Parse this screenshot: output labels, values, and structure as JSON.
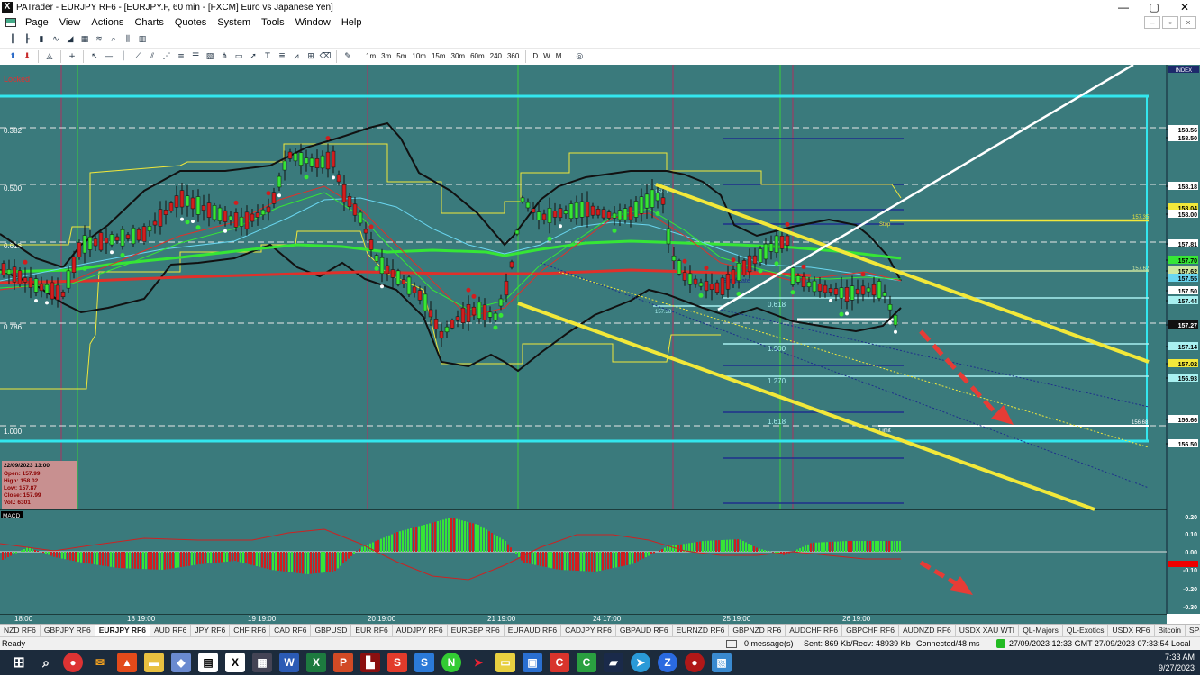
{
  "window": {
    "title": "PATrader - EURJPY RF6 - [EURJPY.F, 60 min - [FXCM] Euro vs Japanese Yen]",
    "controls": [
      "—",
      "▢",
      "✕"
    ]
  },
  "menu": [
    "Page",
    "View",
    "Actions",
    "Charts",
    "Quotes",
    "System",
    "Tools",
    "Window",
    "Help"
  ],
  "timeframes": [
    "1m",
    "3m",
    "5m",
    "10m",
    "15m",
    "30m",
    "60m",
    "240",
    "360",
    "D",
    "W",
    "M"
  ],
  "chart": {
    "locked": "Locked",
    "fib_left": [
      "0.382",
      "0.500",
      "0.618",
      "0.786",
      "1.000"
    ],
    "price_axis": [
      "158.56",
      "158.50",
      "158.18",
      "158.04",
      "158.00",
      "157.81",
      "157.70",
      "157.62",
      "157.55",
      "157.50",
      "157.44",
      "157.27",
      "157.14",
      "157.02",
      "156.93",
      "156.66",
      "156.50"
    ],
    "index_label": "INDEX",
    "macd_label": "MACD",
    "macd_axis": [
      "0.20",
      "0.10",
      "0.00",
      "-0.08",
      "-0.10",
      "-0.20",
      "-0.30"
    ],
    "time_axis": [
      "18:00",
      "18 19:00",
      "19 19:00",
      "20 19:00",
      "21 19:00",
      "24 17:00",
      "25 19:00",
      "26 19:00"
    ],
    "fib_mid": [
      "0.618",
      "1.000",
      "1.270",
      "1.618"
    ],
    "labels": {
      "stop": "Stop",
      "limit": "Limit",
      "syndicate": "Syndicate",
      "l157_35": "157.35",
      "l157_62": "157.62",
      "l157_38": "157.38",
      "l156_68": "156.68",
      "l158_x": "158.1"
    },
    "ohlc": {
      "date": "22/09/2023 13:00",
      "open": "Open: 157.99",
      "high": "High: 158.02",
      "low": "Low: 157.87",
      "close": "Close: 157.99",
      "vol": "Vol.: 6301"
    },
    "colors": {
      "bg": "#3a7a7c",
      "cyan": "#33e6ee",
      "yellow": "#f2e83a",
      "red": "#d21e1e",
      "green": "#36e636",
      "white": "#ffffff"
    }
  },
  "tabs": [
    "NZD RF6",
    "GBPJPY RF6",
    "EURJPY RF6",
    "AUD RF6",
    "JPY RF6",
    "CHF RF6",
    "CAD RF6",
    "GBPUSD",
    "EUR RF6",
    "AUDJPY RF6",
    "EURGBP RF6",
    "EURAUD RF6",
    "CADJPY RF6",
    "GBPAUD RF6",
    "EURNZD RF6",
    "GBPNZD RF6",
    "AUDCHF RF6",
    "GBPCHF RF6",
    "AUDNZD RF6",
    "USDX XAU WTI",
    "QL-Majors",
    "QL-Exotics",
    "USDX RF6",
    "Bitcoin",
    "SP500",
    "DJIA"
  ],
  "active_tab": "EURJPY RF6",
  "status": {
    "ready": "Ready",
    "messages": "0 message(s)",
    "traffic": "Sent: 869 Kb/Recv: 48939 Kb",
    "connected": "Connected/48 ms",
    "clock": "27/09/2023 12:33 GMT  27/09/2023 07:33:54 Local"
  },
  "taskbar": {
    "time": "7:33 AM",
    "date": "9/27/2023"
  }
}
